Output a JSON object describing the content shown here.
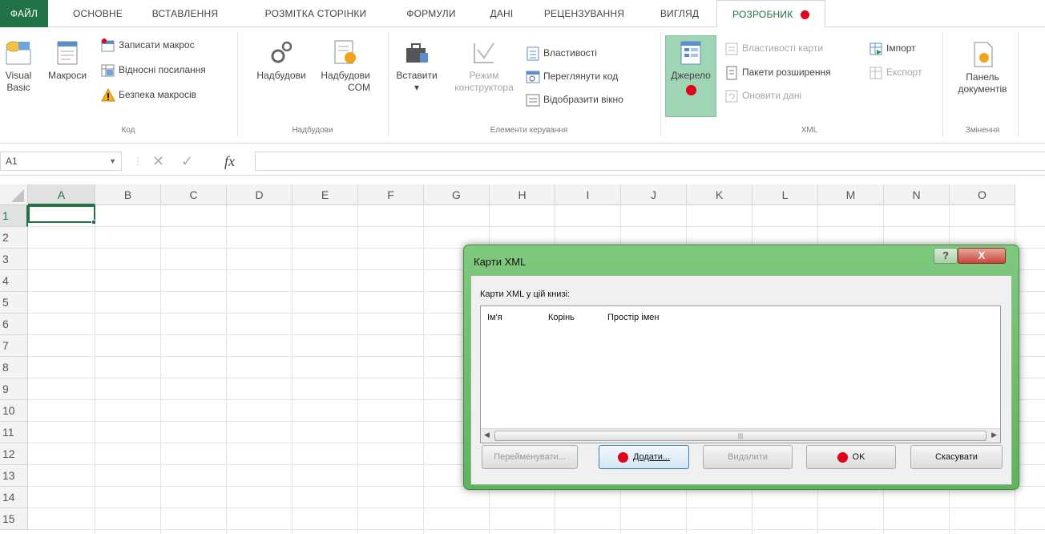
{
  "ribbon_tabs": {
    "file": "ФАЙЛ",
    "home": "ОСНОВНЕ",
    "insert": "ВСТАВЛЕННЯ",
    "page_layout": "РОЗМІТКА СТОРІНКИ",
    "formulas": "ФОРМУЛИ",
    "data": "ДАНІ",
    "review": "РЕЦЕНЗУВАННЯ",
    "view": "ВИГЛЯД",
    "developer": "РОЗРОБНИК"
  },
  "ribbon": {
    "code": {
      "label": "Код",
      "visual_basic_l1": "Visual",
      "visual_basic_l2": "Basic",
      "macros": "Макроси",
      "record_macro": "Записати макрос",
      "relative_refs": "Відносні посилання",
      "macro_security": "Безпека макросів"
    },
    "addins": {
      "label": "Надбудови",
      "addins": "Надбудови",
      "com_addins_l1": "Надбудови",
      "com_addins_l2": "COM"
    },
    "controls": {
      "label": "Елементи керування",
      "insert": "Вставити",
      "design_mode_l1": "Режим",
      "design_mode_l2": "конструктора",
      "properties": "Властивості",
      "view_code": "Переглянути код",
      "run_dialog": "Відобразити вікно"
    },
    "xml": {
      "label": "XML",
      "source": "Джерело",
      "map_properties": "Властивості карти",
      "expansion_packs": "Пакети розширення",
      "refresh_data": "Оновити дані",
      "import": "Імпорт",
      "export": "Експорт"
    },
    "modify": {
      "label": "Змінення",
      "document_panel_l1": "Панель",
      "document_panel_l2": "документів"
    }
  },
  "formula_bar": {
    "name_box": "A1",
    "cancel": "✕",
    "enter": "✓",
    "fx": "fx",
    "value": ""
  },
  "grid": {
    "columns": [
      "A",
      "B",
      "C",
      "D",
      "E",
      "F",
      "G",
      "H",
      "I",
      "J",
      "K",
      "L",
      "M",
      "N",
      "O"
    ],
    "rows": [
      "1",
      "2",
      "3",
      "4",
      "5",
      "6",
      "7",
      "8",
      "9",
      "10",
      "11",
      "12",
      "13",
      "14",
      "15"
    ]
  },
  "dialog": {
    "title": "Карти XML",
    "help": "?",
    "close": "X",
    "list_label": "Карти XML у цій книзі:",
    "col_name": "Ім'я",
    "col_root": "Корінь",
    "col_namespace": "Простір імен",
    "scroll_left": "◀",
    "scroll_right": "▶",
    "scroll_grip": "|||",
    "btn_rename": "Перейменувати...",
    "btn_add": "Додати...",
    "btn_delete": "Видалити",
    "btn_ok": "OK",
    "btn_cancel": "Скасувати"
  },
  "colors": {
    "accent": "#217346",
    "marker": "#e3001b",
    "dialog_frame": "#6fbf6f"
  }
}
